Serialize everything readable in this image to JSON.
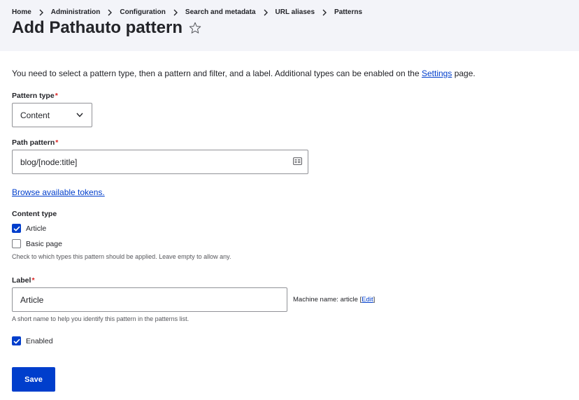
{
  "breadcrumb": {
    "items": [
      "Home",
      "Administration",
      "Configuration",
      "Search and metadata",
      "URL aliases",
      "Patterns"
    ]
  },
  "page": {
    "title": "Add Pathauto pattern",
    "intro_text": "You need to select a pattern type, then a pattern and filter, and a label. Additional types can be enabled on the ",
    "intro_link": "Settings",
    "intro_suffix": " page."
  },
  "pattern_type": {
    "label": "Pattern type",
    "required_mark": "*",
    "selected": "Content"
  },
  "path_pattern": {
    "label": "Path pattern",
    "required_mark": "*",
    "value": "blog/[node:title]"
  },
  "browse_tokens": {
    "label": "Browse available tokens."
  },
  "content_type": {
    "label": "Content type",
    "options": [
      {
        "label": "Article",
        "checked": true
      },
      {
        "label": "Basic page",
        "checked": false
      }
    ],
    "description": "Check to which types this pattern should be applied. Leave empty to allow any."
  },
  "label_field": {
    "label": "Label",
    "required_mark": "*",
    "value": "Article",
    "machine_name_prefix": "Machine name: article ",
    "machine_name_edit": "Edit",
    "description": "A short name to help you identify this pattern in the patterns list."
  },
  "enabled": {
    "label": "Enabled",
    "checked": true
  },
  "actions": {
    "save_label": "Save"
  },
  "colors": {
    "accent": "#003ecc",
    "header_bg": "#f3f4f9",
    "required": "#dc2323",
    "text": "#232429"
  }
}
